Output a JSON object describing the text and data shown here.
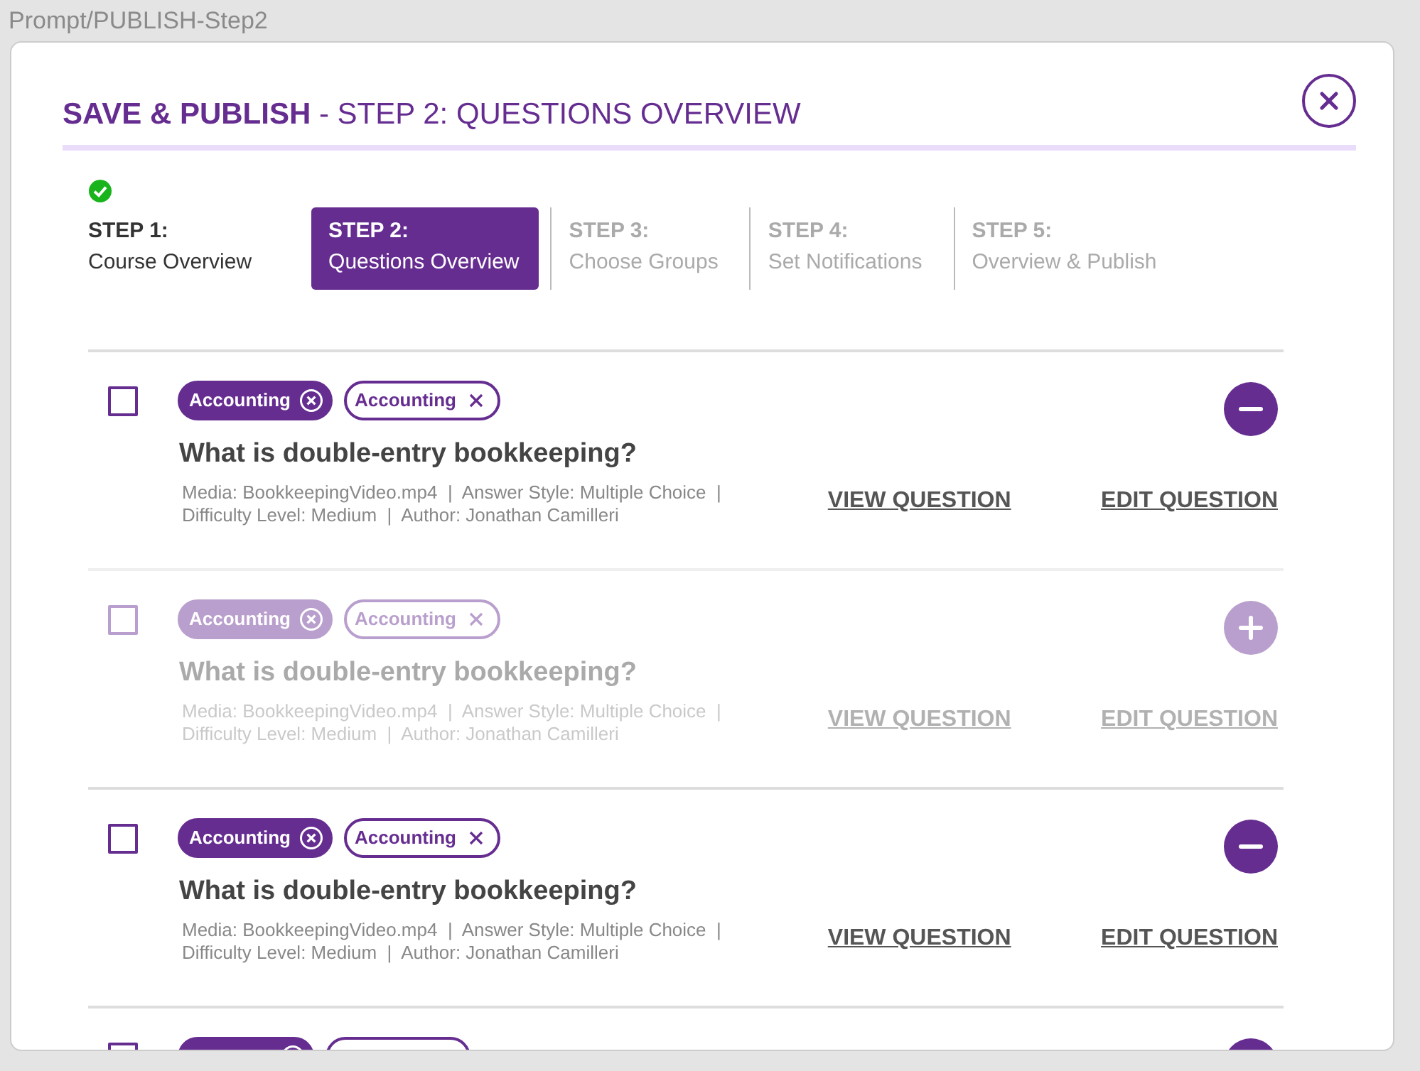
{
  "frame_label": "Prompt/PUBLISH-Step2",
  "dialog": {
    "title_bold": "SAVE & PUBLISH",
    "title_rest": " - STEP 2: QUESTIONS OVERVIEW"
  },
  "steps": [
    {
      "number": "STEP 1:",
      "label": "Course Overview",
      "completed": true,
      "selected": false
    },
    {
      "number": "STEP 2:",
      "label": "Questions Overview",
      "completed": false,
      "selected": true
    },
    {
      "number": "STEP 3:",
      "label": "Choose Groups",
      "completed": false,
      "selected": false
    },
    {
      "number": "STEP 4:",
      "label": "Set Notifications",
      "completed": false,
      "selected": false
    },
    {
      "number": "STEP 5:",
      "label": "Overview & Publish",
      "completed": false,
      "selected": false
    }
  ],
  "questions": [
    {
      "checked": false,
      "included": true,
      "tags": [
        {
          "label": "Accounting",
          "kind": "filled"
        },
        {
          "label": "Accounting",
          "kind": "outline"
        }
      ],
      "title": "What is double-entry bookkeeping?",
      "meta_1": "Media: BookkeepingVideo.mp4  |  Answer Style: Multiple Choice  |",
      "meta_2": "Difficulty Level: Medium  |  Author: Jonathan Camilleri",
      "view": "VIEW QUESTION",
      "edit": "EDIT QUESTION"
    },
    {
      "checked": false,
      "included": false,
      "tags": [
        {
          "label": "Accounting",
          "kind": "filled"
        },
        {
          "label": "Accounting",
          "kind": "outline"
        }
      ],
      "title": "What is double-entry bookkeeping?",
      "meta_1": "Media: BookkeepingVideo.mp4  |  Answer Style: Multiple Choice  |",
      "meta_2": "Difficulty Level: Medium  |  Author: Jonathan Camilleri",
      "view": "VIEW QUESTION",
      "edit": "EDIT QUESTION"
    },
    {
      "checked": false,
      "included": true,
      "tags": [
        {
          "label": "Accounting",
          "kind": "filled"
        },
        {
          "label": "Accounting",
          "kind": "outline"
        }
      ],
      "title": "What is double-entry bookkeeping?",
      "meta_1": "Media: BookkeepingVideo.mp4  |  Answer Style: Multiple Choice  |",
      "meta_2": "Difficulty Level: Medium  |  Author: Jonathan Camilleri",
      "view": "VIEW QUESTION",
      "edit": "EDIT QUESTION"
    },
    {
      "checked": false,
      "included": true,
      "tags": [
        {
          "kind": "filled"
        },
        {
          "kind": "outline"
        }
      ]
    }
  ]
}
